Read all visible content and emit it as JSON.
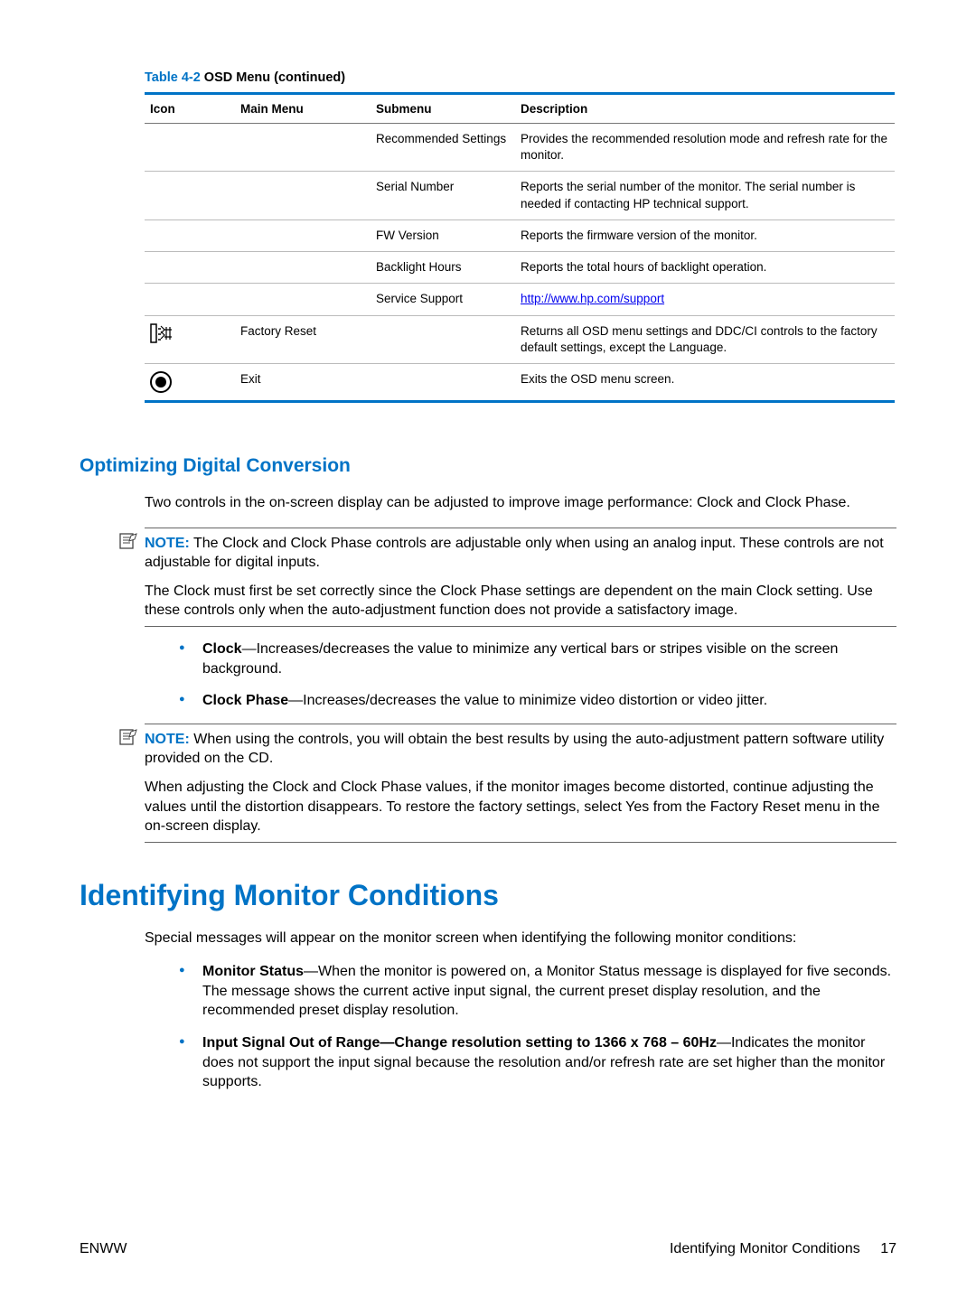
{
  "table_caption_prefix": "Table 4-2",
  "table_caption_body": "  OSD Menu (continued)",
  "headers": {
    "icon": "Icon",
    "main_menu": "Main Menu",
    "submenu": "Submenu",
    "description": "Description"
  },
  "rows": [
    {
      "icon": "",
      "main": "",
      "sub": "Recommended Settings",
      "desc": "Provides the recommended resolution mode and refresh rate for the monitor."
    },
    {
      "icon": "",
      "main": "",
      "sub": "Serial Number",
      "desc": "Reports the serial number of the monitor. The serial number is needed if contacting HP technical support."
    },
    {
      "icon": "",
      "main": "",
      "sub": "FW Version",
      "desc": "Reports the firmware version of the monitor."
    },
    {
      "icon": "",
      "main": "",
      "sub": "Backlight Hours",
      "desc": "Reports the total hours of backlight operation."
    },
    {
      "icon": "",
      "main": "",
      "sub": "Service Support",
      "desc_link": "http://www.hp.com/support"
    },
    {
      "icon": "factory",
      "main": "Factory Reset",
      "sub": "",
      "desc": "Returns all OSD menu settings and DDC/CI controls to the factory default settings, except the Language."
    },
    {
      "icon": "exit",
      "main": "Exit",
      "sub": "",
      "desc": "Exits the OSD menu screen."
    }
  ],
  "section_heading": "Optimizing Digital Conversion",
  "para1": "Two controls in the on-screen display can be adjusted to improve image performance: Clock and Clock Phase.",
  "note1_label": "NOTE:",
  "note1_text": "   The Clock and Clock Phase controls are adjustable only when using an analog input. These controls are not adjustable for digital inputs.",
  "para2": "The Clock must first be set correctly since the Clock Phase settings are dependent on the main Clock setting. Use these controls only when the auto-adjustment function does not provide a satisfactory image.",
  "clock_bold": "Clock",
  "clock_text": "—Increases/decreases the value to minimize any vertical bars or stripes visible on the screen background.",
  "clockphase_bold": "Clock Phase",
  "clockphase_text": "—Increases/decreases the value to minimize video distortion or video jitter.",
  "note2_label": "NOTE:",
  "note2_text": "   When using the controls, you will obtain the best results by using the auto-adjustment pattern software utility provided on the CD.",
  "para3": "When adjusting the Clock and Clock Phase values, if the monitor images become distorted, continue adjusting the values until the distortion disappears. To restore the factory settings, select Yes from the Factory Reset menu in the on-screen display.",
  "h1": "Identifying Monitor Conditions",
  "para4": "Special messages will appear on the monitor screen when identifying the following monitor conditions:",
  "monstatus_bold": "Monitor Status",
  "monstatus_text": "—When the monitor is powered on, a Monitor Status message is displayed for five seconds. The message shows the current active input signal, the current preset display resolution, and the recommended preset display resolution.",
  "inputsig_bold": "Input Signal Out of Range—Change resolution setting to 1366 x 768 – 60Hz",
  "inputsig_text": "—Indicates the monitor does not support the input signal because the resolution and/or refresh rate are set higher than the monitor supports.",
  "footer_left": "ENWW",
  "footer_right": "Identifying Monitor Conditions",
  "page_num": "17"
}
